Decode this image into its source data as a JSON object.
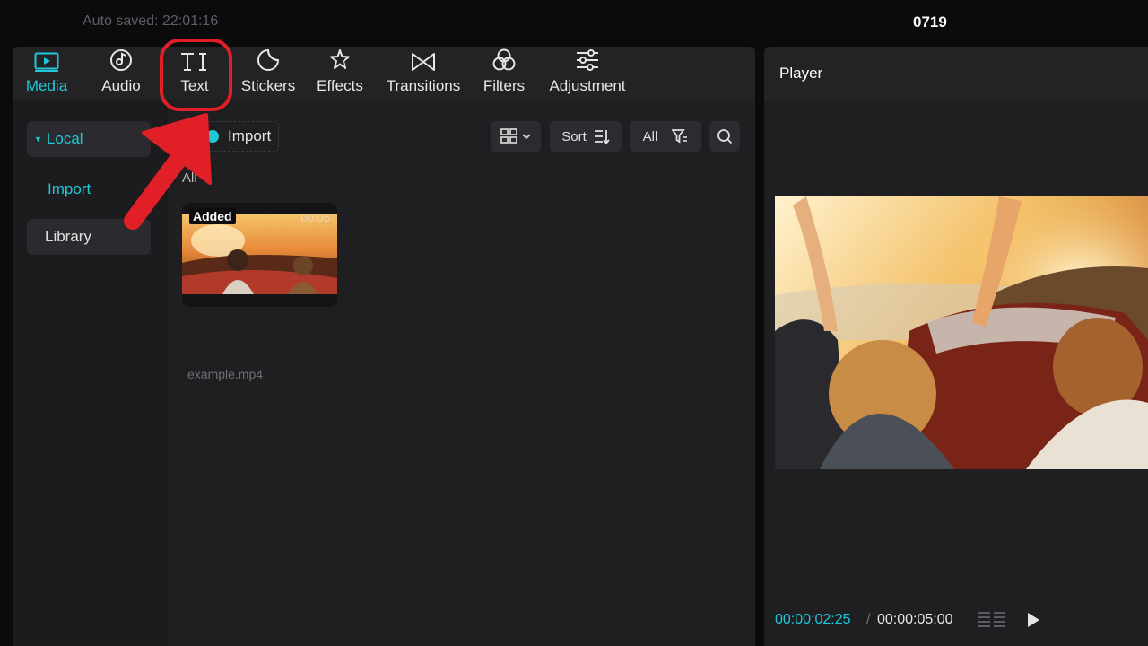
{
  "topbar": {
    "autosave": "Auto saved: 22:01:16",
    "project_title": "0719"
  },
  "tabs": [
    {
      "label": "Media",
      "icon": "media-icon",
      "active": true
    },
    {
      "label": "Audio",
      "icon": "audio-icon",
      "active": false
    },
    {
      "label": "Text",
      "icon": "text-icon",
      "active": false
    },
    {
      "label": "Stickers",
      "icon": "stickers-icon",
      "active": false
    },
    {
      "label": "Effects",
      "icon": "effects-icon",
      "active": false
    },
    {
      "label": "Transitions",
      "icon": "transitions-icon",
      "active": false
    },
    {
      "label": "Filters",
      "icon": "filters-icon",
      "active": false
    },
    {
      "label": "Adjustment",
      "icon": "adjustment-icon",
      "active": false
    }
  ],
  "sidebar": {
    "local": "Local",
    "import": "Import",
    "library": "Library"
  },
  "toolbar": {
    "import": "Import",
    "sort": "Sort",
    "filter_all": "All"
  },
  "media": {
    "section_label": "All",
    "items": [
      {
        "badge": "Added",
        "duration": "00:05",
        "filename": "example.mp4"
      }
    ]
  },
  "player": {
    "title": "Player",
    "current_time": "00:00:02:25",
    "separator": "/",
    "total_time": "00:00:05:00"
  },
  "colors": {
    "accent": "#1fc8d8",
    "highlight": "#e01f26"
  }
}
